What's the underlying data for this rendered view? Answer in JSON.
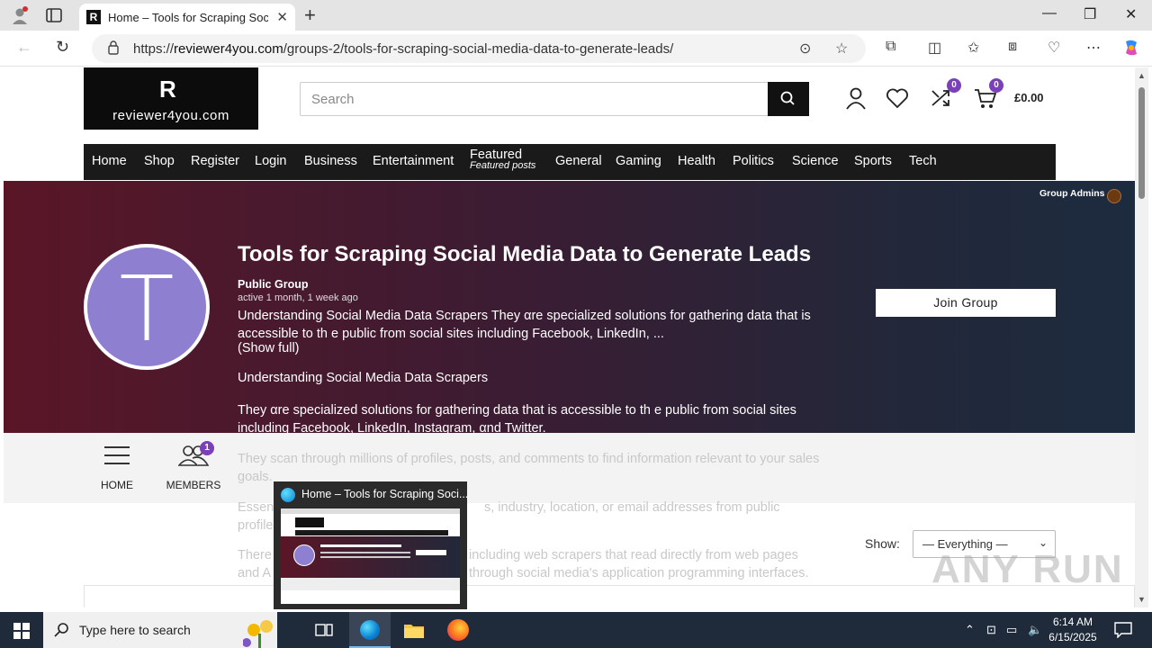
{
  "browser": {
    "tab_title": "Home – Tools for Scraping Social",
    "url_prefix": "https://",
    "url_host": "reviewer4you.com",
    "url_path": "/groups-2/tools-for-scraping-social-media-data-to-generate-leads/",
    "tab_favicon_letter": "R"
  },
  "site": {
    "logo_mark": "R",
    "logo_name": "reviewer4you.com",
    "search_placeholder": "Search",
    "compare_count": "0",
    "cart_count": "0",
    "cart_total": "£0.00"
  },
  "menu": {
    "items": [
      "Home",
      "Shop",
      "Register",
      "Login",
      "Business",
      "Entertainment",
      "Featured",
      "General",
      "Gaming",
      "Health",
      "Politics",
      "Science",
      "Sports",
      "Tech"
    ],
    "featured_sub": "Featured posts"
  },
  "group": {
    "admins_label": "Group Admins",
    "avatar_letter": "T",
    "title": "Tools for Scraping Social Media Data to Generate Leads",
    "type": "Public Group",
    "active": "active 1 month, 1 week ago",
    "excerpt": "Understanding Social Media Data Scrapers They αre specialized solutions for gathering data that is accessible to th е public from social sites including Facebook, LinkedIn, ...",
    "show_full": "(Show full)",
    "para1": "Understanding Social Media Data Scrapers",
    "para2": "They αre specialized solutions for gathering data that is accessible to th е public from social sites including Facebook, LinkedIn, Instagram, αnd Twitter.",
    "para3": "They scan through millions of profiles, posts, and comments to find information relevant to your sales goals.",
    "para4_a": "Essen",
    "para4_b": "s, industry, location, or email addresses from public",
    "para4_c": "profile",
    "para5_a": "There",
    "para5_b": "including web scrapers that read directly from web pages",
    "para5_c": "and A",
    "para5_d": "through social media's application programming interfaces.",
    "join_label": "Join Group"
  },
  "subnav": {
    "home_label": "HOME",
    "members_label": "MEMBERS",
    "members_count": "1"
  },
  "filter": {
    "show_label": "Show:",
    "selected": "— Everything —"
  },
  "preview": {
    "title": "Home – Tools for Scraping Soci..."
  },
  "taskbar": {
    "search_placeholder": "Type here to search",
    "time": "6:14 AM",
    "date": "6/15/2025"
  },
  "watermark": "ANY RUN"
}
